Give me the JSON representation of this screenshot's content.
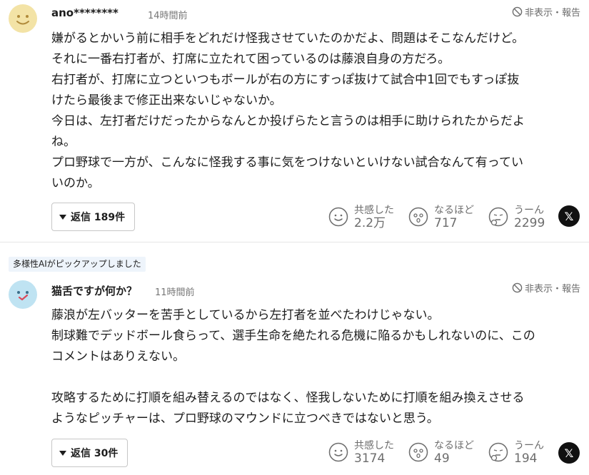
{
  "comments": [
    {
      "user": "ano********",
      "time": "14時間前",
      "hide_report": "非表示・報告",
      "avatar": "smile-face-icon",
      "body": [
        "嫌がるとかいう前に相手をどれだけ怪我させていたのかだよ、問題はそこなんだけど。",
        "それに一番右打者が、打席に立たれて困っているのは藤浪自身の方だろ。",
        "右打者が、打席に立つといつもボールが右の方にすっぽ抜けて試合中1回でもすっぽ抜",
        "けたら最後まで修正出来ないじゃないか。",
        "今日は、左打者だけだったからなんとか投げらたと言うのは相手に助けられたからだよ",
        "ね。",
        "プロ野球で一方が、こんなに怪我する事に気をつけないといけない試合なんて有ってい",
        "いのか。"
      ],
      "reply_label": "返信 189件",
      "reactions": [
        {
          "label": "共感した",
          "count": "2.2万",
          "icon": "empathy-icon"
        },
        {
          "label": "なるほど",
          "count": "717",
          "icon": "insight-icon"
        },
        {
          "label": "うーん",
          "count": "2299",
          "icon": "hmm-icon"
        }
      ],
      "share_label": "𝕏"
    },
    {
      "badge": "多様性AIがピックアップしました",
      "user": "猫舌ですが何か？",
      "time": "11時間前",
      "hide_report": "非表示・報告",
      "avatar": "cat-face-icon",
      "body": [
        "藤浪が左バッターを苦手としているから左打者を並べたわけじゃない。",
        "制球難でデッドボール食らって、選手生命を絶たれる危機に陥るかもしれないのに、この",
        "コメントはありえない。",
        "",
        "攻略するために打順を組み替えるのではなく、怪我しないために打順を組み換えさせる",
        "ようなピッチャーは、プロ野球のマウンドに立つべきではないと思う。"
      ],
      "reply_label": "返信 30件",
      "reactions": [
        {
          "label": "共感した",
          "count": "3174",
          "icon": "empathy-icon"
        },
        {
          "label": "なるほど",
          "count": "49",
          "icon": "insight-icon"
        },
        {
          "label": "うーん",
          "count": "194",
          "icon": "hmm-icon"
        }
      ],
      "share_label": "𝕏"
    }
  ],
  "colors": {
    "text": "#1d1d1d",
    "muted": "#6d6d6d",
    "avatar1": "#f3e3a6",
    "avatar2": "#bfe3f2",
    "badge_bg": "#eef4fb"
  }
}
